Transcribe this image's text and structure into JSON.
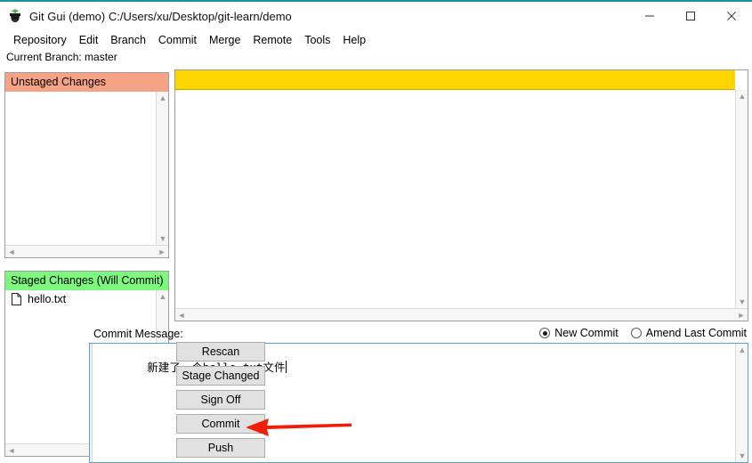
{
  "window": {
    "icon": "git-gui-icon",
    "title": "Git Gui (demo) C:/Users/xu/Desktop/git-learn/demo",
    "controls": {
      "minimize": "minimize-icon",
      "maximize": "maximize-icon",
      "close": "close-icon"
    }
  },
  "menubar": {
    "items": [
      {
        "label": "Repository"
      },
      {
        "label": "Edit"
      },
      {
        "label": "Branch"
      },
      {
        "label": "Commit"
      },
      {
        "label": "Merge"
      },
      {
        "label": "Remote"
      },
      {
        "label": "Tools"
      },
      {
        "label": "Help"
      }
    ]
  },
  "branchbar": {
    "text": "Current Branch: master"
  },
  "unstaged": {
    "header": "Unstaged Changes",
    "header_color": "#f5a285",
    "files": []
  },
  "staged": {
    "header": "Staged Changes (Will Commit)",
    "header_color": "#7df77d",
    "files": [
      {
        "icon": "file-icon",
        "name": "hello.txt"
      }
    ]
  },
  "diff": {
    "banner_color": "#ffd500",
    "content": ""
  },
  "commit": {
    "label": "Commit Message:",
    "mode_options": [
      {
        "label": "New Commit",
        "selected": true
      },
      {
        "label": "Amend Last Commit",
        "selected": false
      }
    ],
    "message": "新建了一个hello.txt文件"
  },
  "actions": {
    "buttons": [
      {
        "label": "Rescan"
      },
      {
        "label": "Stage Changed"
      },
      {
        "label": "Sign Off"
      },
      {
        "label": "Commit"
      },
      {
        "label": "Push"
      }
    ]
  },
  "annotation": {
    "arrow_color": "#f01e06",
    "points_to": "Commit"
  },
  "scroll": {
    "up": "▲",
    "down": "▼",
    "left": "◄",
    "right": "►"
  }
}
